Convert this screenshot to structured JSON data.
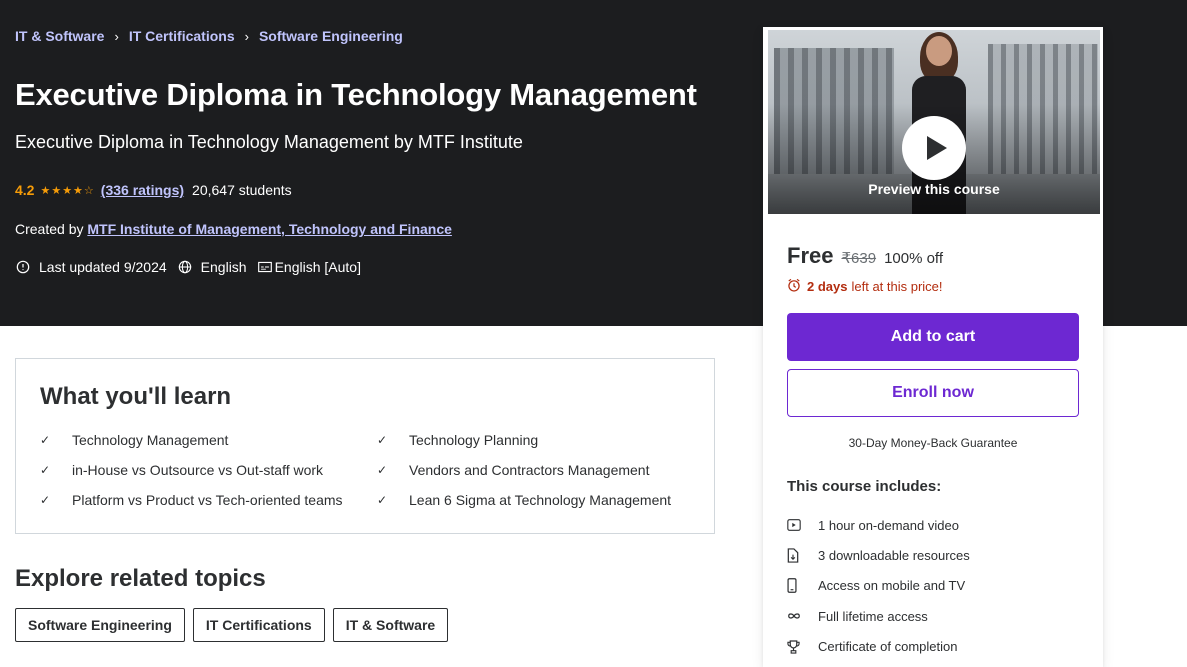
{
  "breadcrumb": [
    "IT & Software",
    "IT Certifications",
    "Software Engineering"
  ],
  "course": {
    "title": "Executive Diploma in Technology Management",
    "subtitle": "Executive Diploma in Technology Management by MTF Institute",
    "rating": "4.2",
    "stars": "★★★★☆",
    "ratings_count": "(336 ratings)",
    "students": "20,647 students",
    "created_by_label": "Created by",
    "instructor": "MTF Institute of Management, Technology and Finance",
    "last_updated": "Last updated 9/2024",
    "language": "English",
    "captions": "English [Auto]"
  },
  "learn": {
    "heading": "What you'll learn",
    "items": [
      "Technology Management",
      "Technology Planning",
      "in-House vs Outsource vs Out-staff work",
      "Vendors and Contractors Management",
      "Platform vs Product vs Tech-oriented teams",
      "Lean 6 Sigma at Technology Management"
    ]
  },
  "related": {
    "heading": "Explore related topics",
    "tags": [
      "Software Engineering",
      "IT Certifications",
      "IT & Software"
    ]
  },
  "card": {
    "preview_label": "Preview this course",
    "price": "Free",
    "old_price": "₹639",
    "discount": "100% off",
    "timer_bold": "2 days",
    "timer_rest": "left at this price!",
    "add_to_cart": "Add to cart",
    "enroll_now": "Enroll now",
    "guarantee": "30-Day Money-Back Guarantee",
    "includes_title": "This course includes:",
    "includes": [
      {
        "icon": "video-icon",
        "text": "1 hour on-demand video"
      },
      {
        "icon": "file-download-icon",
        "text": "3 downloadable resources"
      },
      {
        "icon": "mobile-icon",
        "text": "Access on mobile and TV"
      },
      {
        "icon": "infinity-icon",
        "text": "Full lifetime access"
      },
      {
        "icon": "trophy-icon",
        "text": "Certificate of completion"
      }
    ]
  },
  "colors": {
    "hero_bg": "#1c1d1f",
    "link": "#c0c4fc",
    "star": "#f69c08",
    "brand_purple": "#6d28d2",
    "alert_red": "#b32d0f"
  }
}
